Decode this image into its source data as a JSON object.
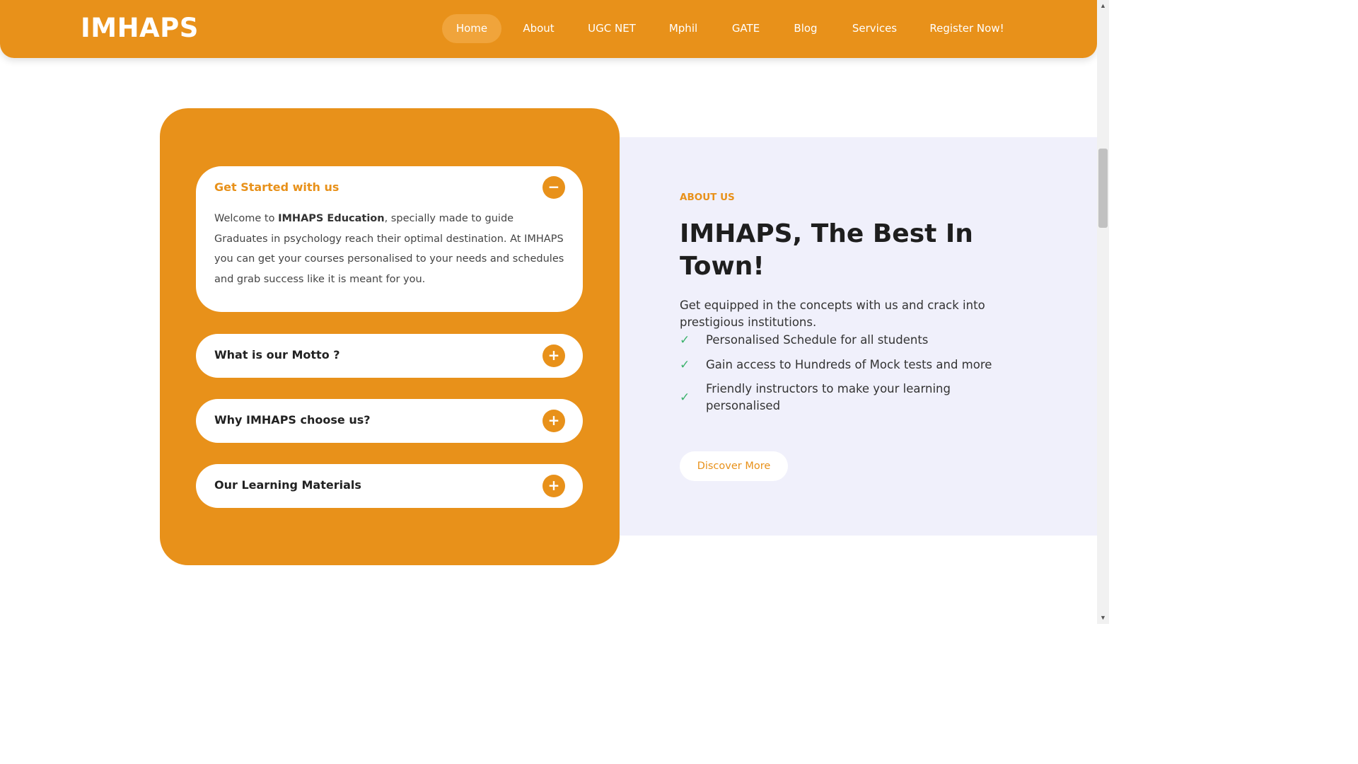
{
  "brand": {
    "logo_text": "IMHAPS",
    "accent_color": "#e8911a",
    "about_bg_color": "#f0f0fb",
    "check_color": "#3bb26b"
  },
  "nav": {
    "items": [
      {
        "label": "Home",
        "active": true
      },
      {
        "label": "About"
      },
      {
        "label": "UGC NET"
      },
      {
        "label": "Mphil"
      },
      {
        "label": "GATE"
      },
      {
        "label": "Blog"
      },
      {
        "label": "Services"
      },
      {
        "label": "Register Now!"
      }
    ]
  },
  "faq": {
    "items": [
      {
        "title": "Get Started with us",
        "expanded": true,
        "toggle_icon": "minus-icon",
        "toggle_symbol": "−",
        "body_prefix": "Welcome to ",
        "body_bold": "IMHAPS Education",
        "body_suffix": ", specially made to guide Graduates in psychology reach their optimal destination. At IMHAPS you can get your courses personalised to your needs and schedules and grab success like it is meant for you."
      },
      {
        "title": "What is our Motto ?",
        "expanded": false,
        "toggle_icon": "plus-icon",
        "toggle_symbol": "+"
      },
      {
        "title": "Why IMHAPS choose us?",
        "expanded": false,
        "toggle_icon": "plus-icon",
        "toggle_symbol": "+"
      },
      {
        "title": "Our Learning Materials",
        "expanded": false,
        "toggle_icon": "plus-icon",
        "toggle_symbol": "+"
      }
    ]
  },
  "about": {
    "eyebrow": "ABOUT US",
    "heading": "IMHAPS, The Best In Town!",
    "description": "Get equipped in the concepts with us and crack into prestigious institutions.",
    "features": [
      {
        "icon": "check-icon",
        "symbol": "✓",
        "text": "Personalised Schedule for all students"
      },
      {
        "icon": "check-icon",
        "symbol": "✓",
        "text": "Gain access to Hundreds of Mock tests and more"
      },
      {
        "icon": "check-icon",
        "symbol": "✓",
        "text": "Friendly instructors to make your learning personalised"
      }
    ],
    "cta_label": "Discover More"
  },
  "scrollbar": {
    "up_symbol": "▲",
    "down_symbol": "▼"
  }
}
